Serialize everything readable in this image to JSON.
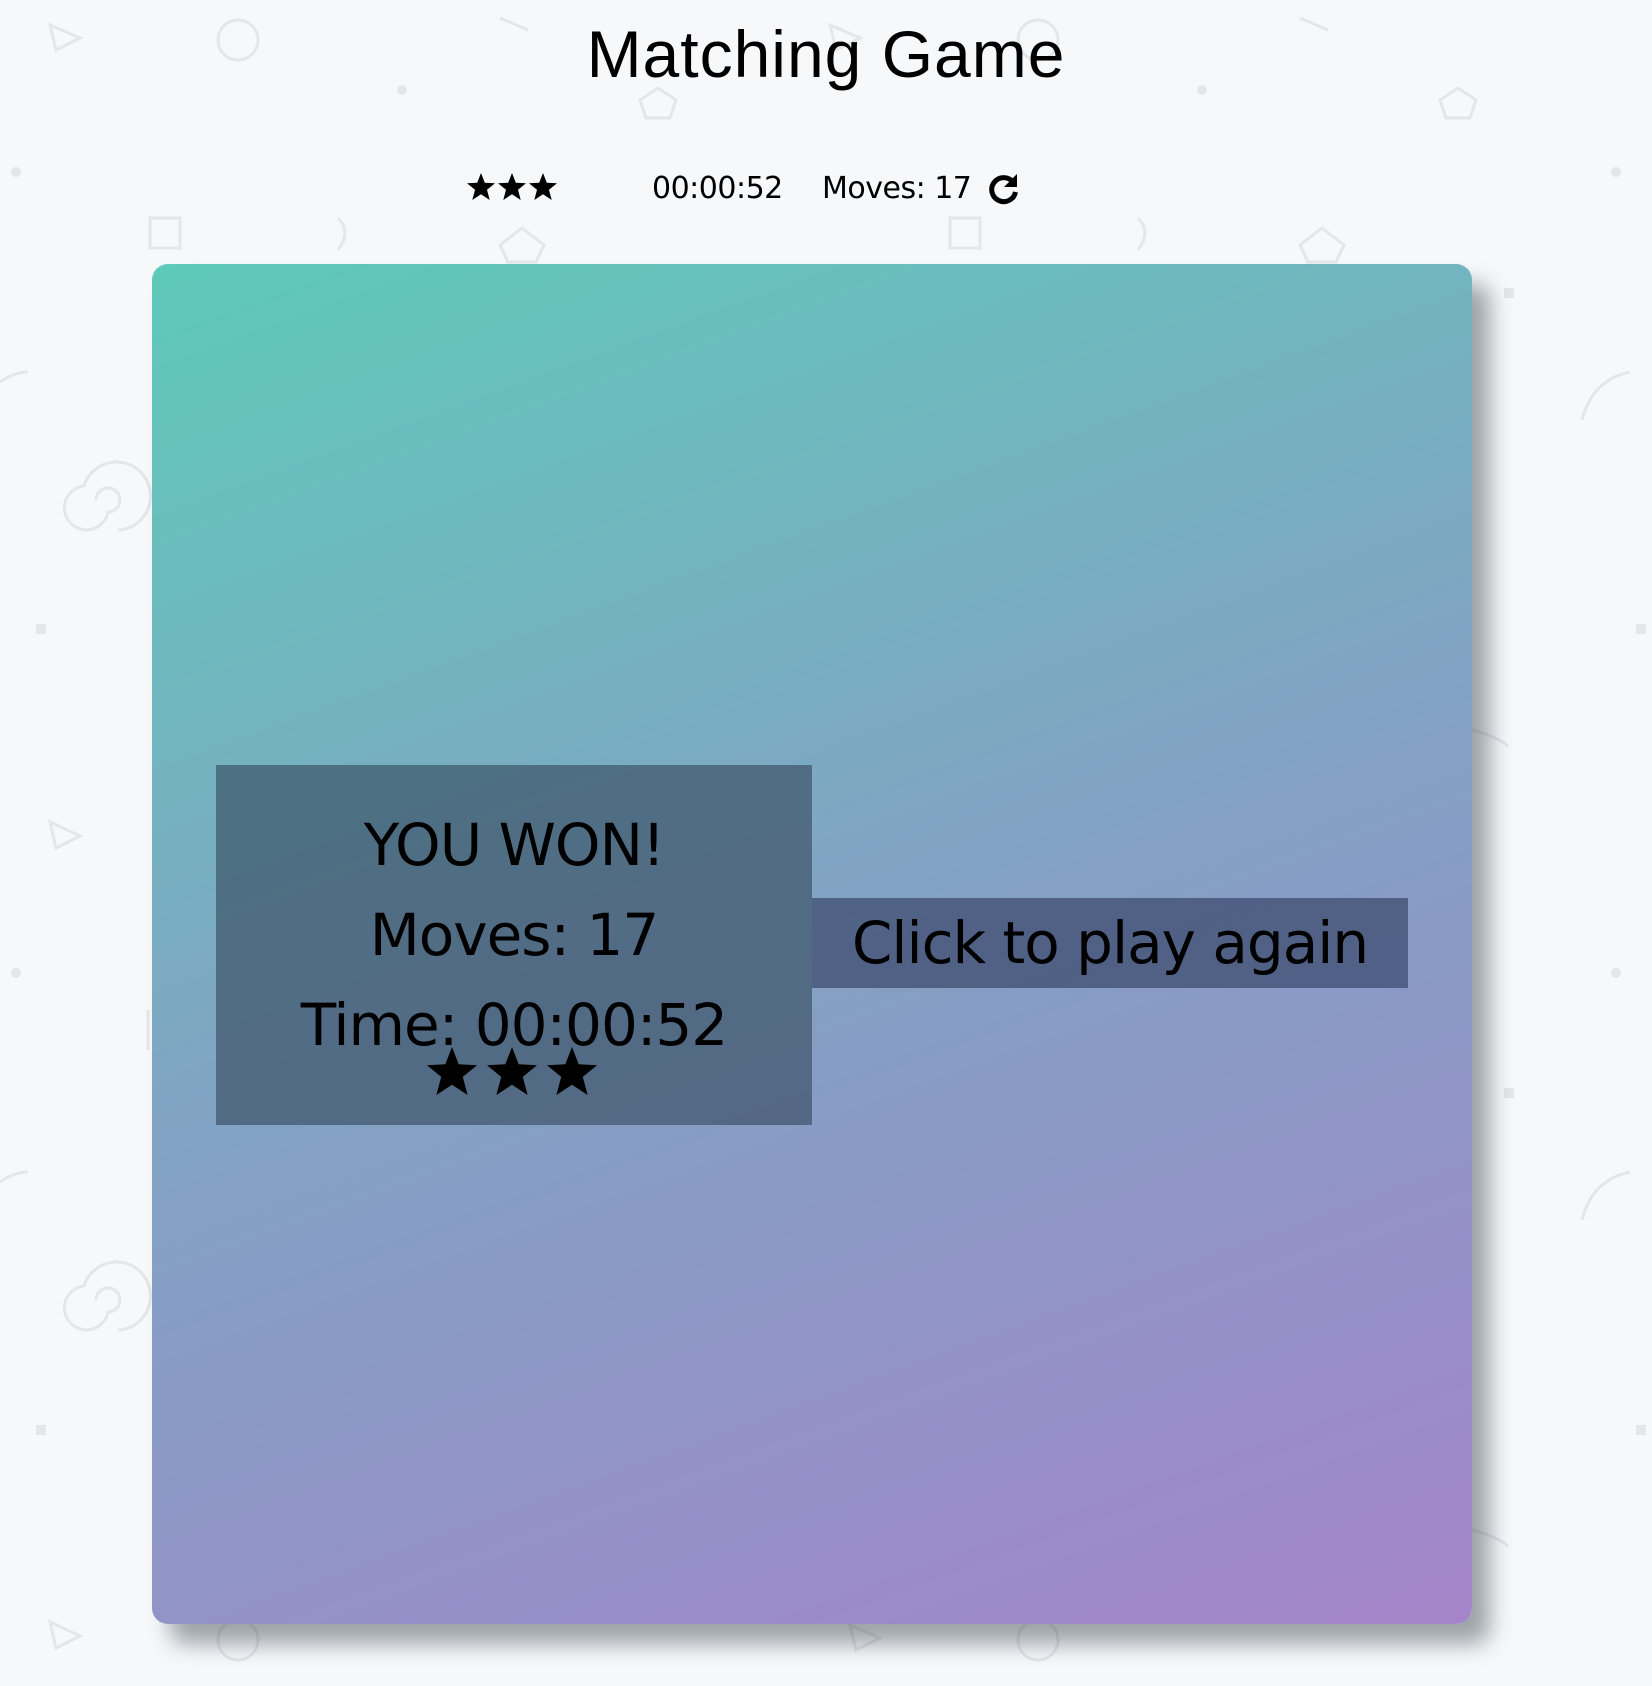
{
  "header": {
    "title": "Matching Game"
  },
  "score_panel": {
    "star_rating": 3,
    "timer": "00:00:52",
    "moves": "Moves: 17",
    "restart_icon": "restart-icon"
  },
  "win_modal": {
    "title": "YOU WON!",
    "moves": "Moves: 17",
    "time": "Time: 00:00:52",
    "star_rating": 3,
    "play_again": "Click to play again"
  },
  "colors": {
    "background": "#f7f8fa",
    "deck_gradient_start": "#5ecab9",
    "deck_gradient_end": "#a585c9"
  }
}
